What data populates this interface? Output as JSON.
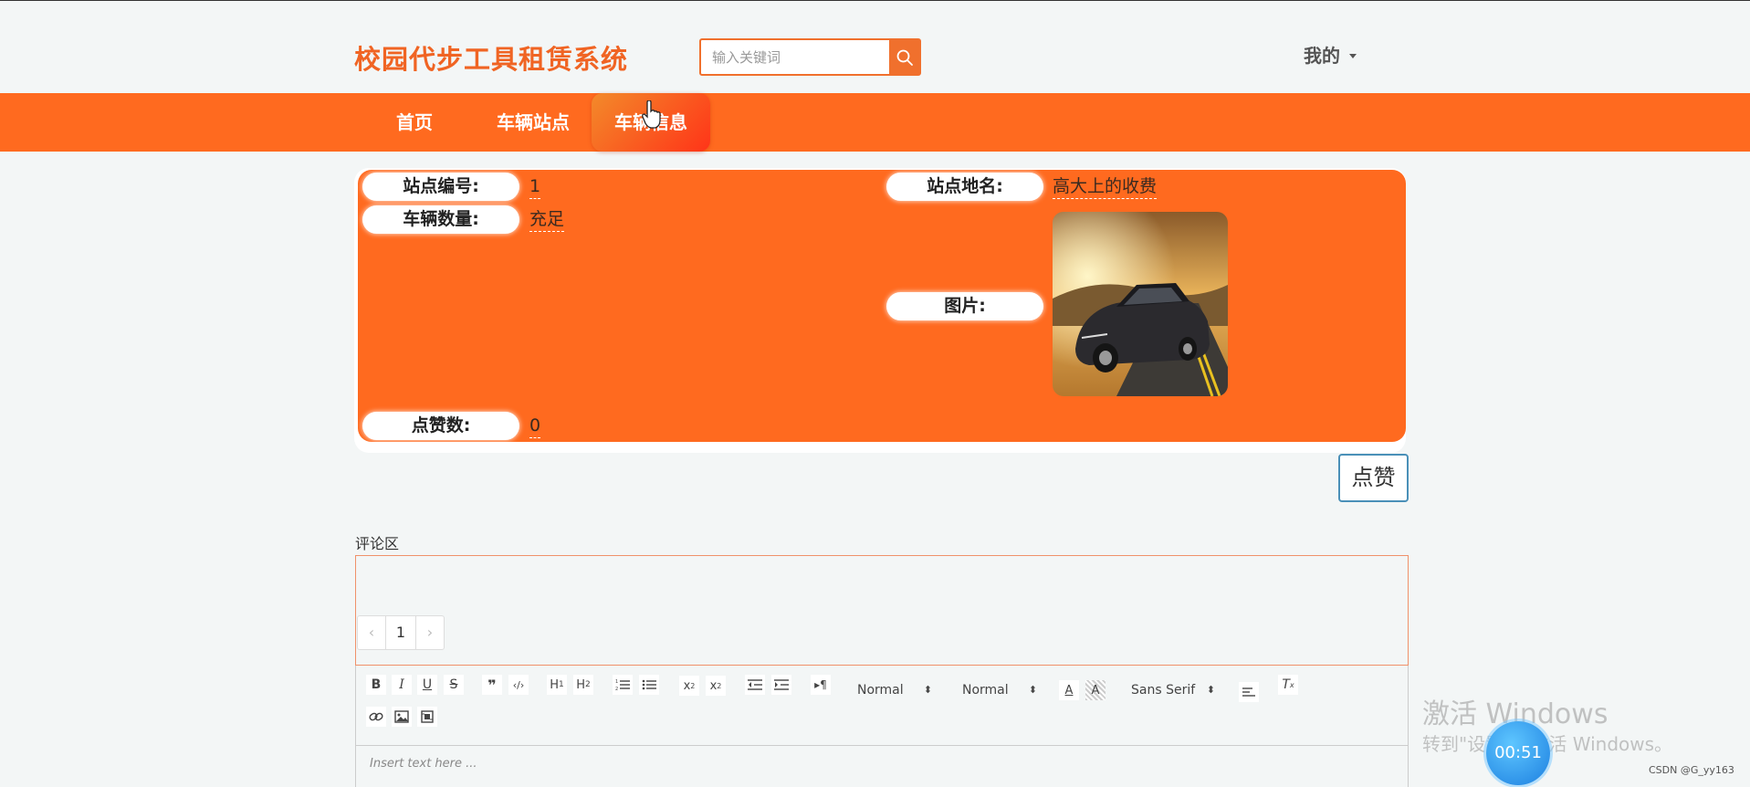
{
  "header": {
    "site_title": "校园代步工具租赁系统",
    "search_placeholder": "输入关键词",
    "user_menu_label": "我的"
  },
  "nav": {
    "items": [
      {
        "label": "首页"
      },
      {
        "label": "车辆站点"
      },
      {
        "label": "车辆信息"
      }
    ],
    "active": "车辆信息"
  },
  "detail": {
    "fields": [
      {
        "label": "站点编号:",
        "value": "1"
      },
      {
        "label": "站点地名:",
        "value": "高大上的收费"
      },
      {
        "label": "车辆数量:",
        "value": "充足"
      },
      {
        "label": "图片:",
        "value": ""
      },
      {
        "label": "点赞数:",
        "value": "0"
      }
    ],
    "like_button": "点赞"
  },
  "comments": {
    "section_label": "评论区",
    "pagination": {
      "prev": "‹",
      "current": "1",
      "next": "›"
    }
  },
  "editor": {
    "format_select": "Normal",
    "size_select": "Normal",
    "font_select": "Sans Serif",
    "placeholder": "Insert text here ..."
  },
  "overlays": {
    "windows_activation_title": "激活 Windows",
    "windows_activation_hint": "转到\"设置\"以激活 Windows。",
    "recording_timer": "00:51",
    "source_watermark": "CSDN @G_yy163"
  },
  "colors": {
    "brand_orange": "#ff6a1f",
    "title_orange": "#f06423",
    "page_background": "#f3f6f6"
  }
}
